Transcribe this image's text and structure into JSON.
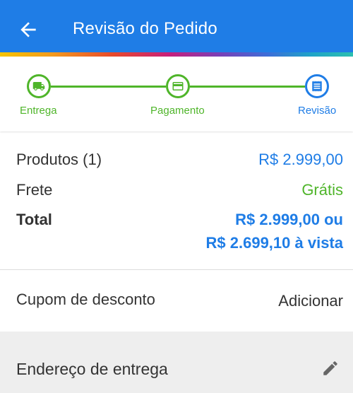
{
  "appbar": {
    "title": "Revisão do Pedido",
    "back_icon": "arrow-back-icon",
    "background": "#1f7de6"
  },
  "stepper": {
    "steps": [
      {
        "label": "Entrega",
        "icon": "truck-icon",
        "state": "done"
      },
      {
        "label": "Pagamento",
        "icon": "credit-card-icon",
        "state": "done"
      },
      {
        "label": "Revisão",
        "icon": "receipt-icon",
        "state": "current"
      }
    ],
    "done_color": "#4fb52a",
    "current_color": "#1f7de6"
  },
  "summary": {
    "products_label": "Produtos (1)",
    "products_value": "R$ 2.999,00",
    "shipping_label": "Frete",
    "shipping_value": "Grátis",
    "total_label": "Total",
    "total_value_line1": "R$ 2.999,00 ou",
    "total_value_line2": "R$ 2.699,10 à vista"
  },
  "coupon": {
    "label": "Cupom de desconto",
    "action": "Adicionar"
  },
  "address": {
    "title": "Endereço de entrega",
    "edit_icon": "pencil-icon"
  }
}
